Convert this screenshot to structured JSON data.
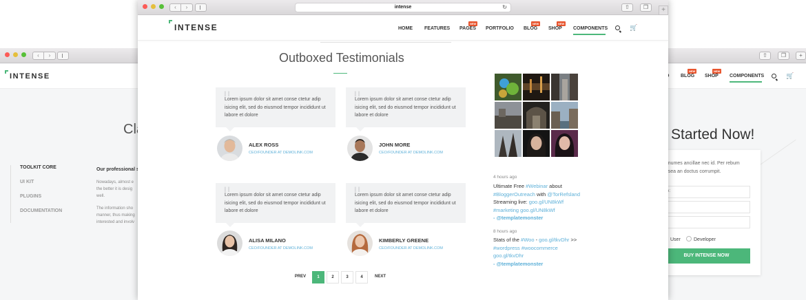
{
  "back_browser": {
    "logo": "INTENSE",
    "nav": {
      "partial_item": "O",
      "blog": "BLOG",
      "shop": "SHOP",
      "components": "COMPONENTS",
      "badge": "NEW"
    },
    "left_heading": "Cla",
    "side_menu": [
      "TOOLKIT CORE",
      "UI KIT",
      "PLUGINS",
      "DOCUMENTATION"
    ],
    "content_heading": "Our professional se",
    "content_p1": [
      "Nowadays, almost e",
      "the better it is desig",
      "well."
    ],
    "content_p2": [
      "The information sho",
      "manner, thus making",
      "interested and involv"
    ],
    "right_heading": "Started Now!",
    "form": {
      "text_lines": [
        "nonumes ancillae nec id. Per rebum",
        "d, sea an doctus corrumpit."
      ],
      "field_label": "me:",
      "radio_user": "User",
      "radio_developer": "Developer",
      "button": "BUY INTENSE NOW"
    }
  },
  "front_browser": {
    "address": "intense",
    "logo": "INTENSE",
    "nav": {
      "home": "HOME",
      "features": "FEATURES",
      "pages": "PAGES",
      "portfolio": "PORTFOLIO",
      "blog": "BLOG",
      "shop": "SHOP",
      "components": "COMPONENTS",
      "badge": "NEW"
    },
    "section_title": "Outboxed Testimonials",
    "testimonials": [
      {
        "text": "Lorem ipsum dolor sit amet conse ctetur adip isicing elit, sed do eiusmod tempor incididunt ut labore et dolore",
        "name": "ALEX ROSS",
        "role": "CEO/FOUNDER AT DEMOLINK.COM"
      },
      {
        "text": "Lorem ipsum dolor sit amet conse ctetur adip isicing elit, sed do eiusmod tempor incididunt ut labore et dolore",
        "name": "JOHN MORE",
        "role": "CEO/FOUNDER AT DEMOLINK.COM"
      },
      {
        "text": "Lorem ipsum dolor sit amet conse ctetur adip isicing elit, sed do eiusmod tempor incididunt ut labore et dolore",
        "name": "ALISA MILANO",
        "role": "CEO/FOUNDER AT DEMOLINK.COM"
      },
      {
        "text": "Lorem ipsum dolor sit amet conse ctetur adip isicing elit, sed do eiusmod tempor incididunt ut labore et dolore",
        "name": "KIMBERLY GREENE",
        "role": "CEO/FOUNDER AT DEMOLINK.COM"
      }
    ],
    "pagination": {
      "prev": "PREV",
      "pages": [
        "1",
        "2",
        "3",
        "4"
      ],
      "next": "NEXT",
      "active": "1"
    },
    "tweets": [
      {
        "time": "4 hours ago",
        "l1a": "Ultimate Free ",
        "l1b": "#Webinar",
        "l1c": " about",
        "l2a": "#BloggerOutreach",
        "l2b": " with ",
        "l2c": "@TorRefsland",
        "l3a": "Streaming live: ",
        "l3b": "goo.gl/UN8kWf",
        "l4": "#marketing goo.gl/UN8kWf",
        "handle": "- @templatemonster"
      },
      {
        "time": "8 hours ago",
        "l1a": "Stats of the ",
        "l1b": "#Woo",
        "l1c": " - ",
        "l1d": "goo.gl/tkvDhr",
        "l1e": " >>",
        "l2": "#wordpress #woocommerce",
        "l3": "goo.gl/tkvDhr",
        "handle": "- @templatemonster"
      }
    ]
  }
}
